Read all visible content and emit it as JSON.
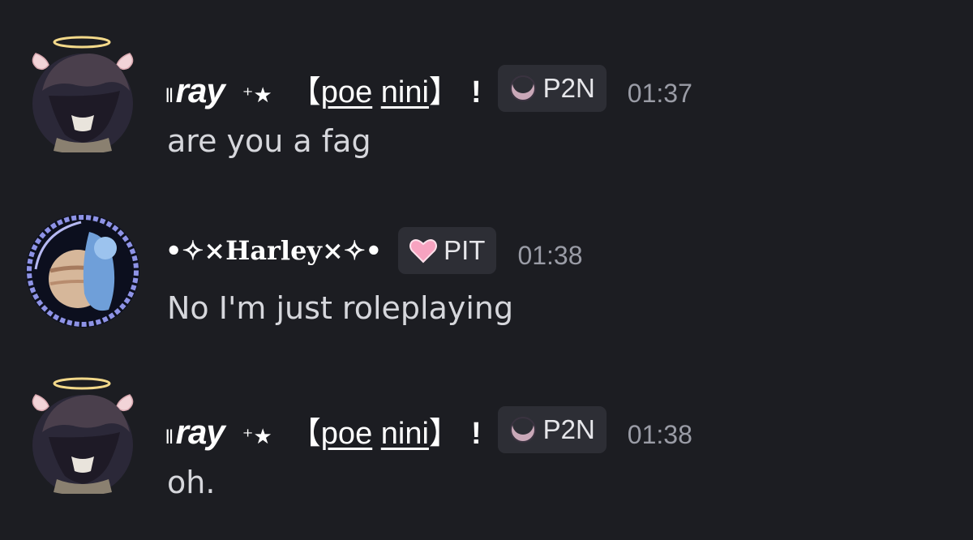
{
  "messages": [
    {
      "avatar": "angel-character-avatar",
      "author": {
        "bars": "ll",
        "name": "ray",
        "stars": "⁺★",
        "bracket_open": "【",
        "bracket_word1": "poe",
        "bracket_word2": "nini",
        "bracket_close": "】",
        "bang": "!"
      },
      "tag": {
        "icon": "crescent-moon-icon",
        "label": "P2N"
      },
      "time": "01:37",
      "text": "are you a fag"
    },
    {
      "avatar": "moon-frame-avatar",
      "author": {
        "name": "•✧×Harley×✧•"
      },
      "tag": {
        "icon": "pink-heart-icon",
        "label": "PIT"
      },
      "time": "01:38",
      "text": "No I'm just roleplaying"
    },
    {
      "avatar": "angel-character-avatar",
      "author": {
        "bars": "ll",
        "name": "ray",
        "stars": "⁺★",
        "bracket_open": "【",
        "bracket_word1": "poe",
        "bracket_word2": "nini",
        "bracket_close": "】",
        "bang": "!"
      },
      "tag": {
        "icon": "crescent-moon-icon",
        "label": "P2N"
      },
      "time": "01:38",
      "text": "oh."
    }
  ],
  "colors": {
    "background": "#1c1d22",
    "tag_background": "#2d2e35",
    "timestamp": "#9a9ca6",
    "message_text": "#d6d7dc",
    "heart": "#f7a3c0",
    "halo": "#f3d98a"
  }
}
